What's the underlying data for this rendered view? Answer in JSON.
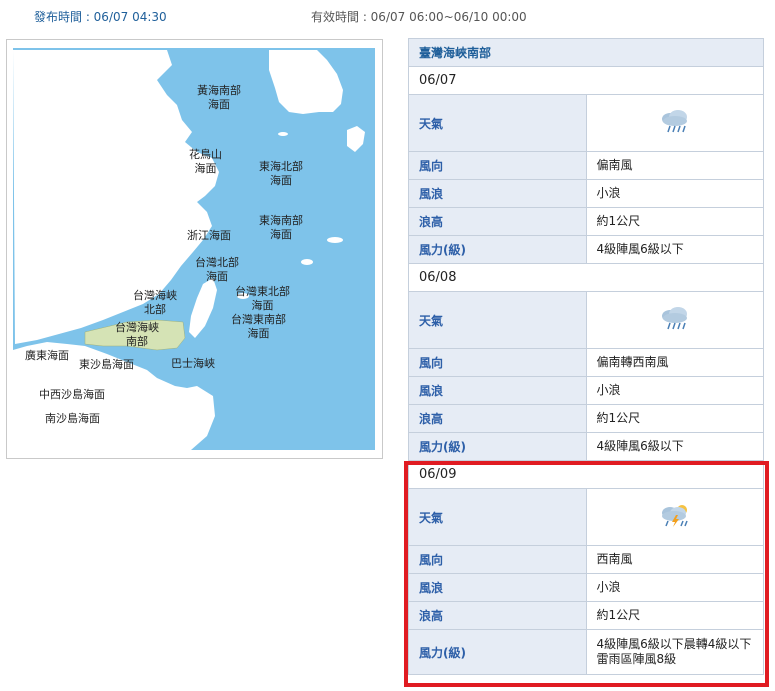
{
  "header": {
    "issue_time": "發布時間 : 06/07 04:30",
    "valid_time": "有效時間 : 06/07 06:00~06/10 00:00"
  },
  "map": {
    "labels": {
      "yellow_sea_south": "黃海南部\n海面",
      "huaniaoshan": "花鳥山\n海面",
      "east_sea_north": "東海北部\n海面",
      "east_sea_south": "東海南部\n海面",
      "zhejiang": "浙江海面",
      "taiwan_north": "台灣北部\n海面",
      "strait_north": "台灣海峽\n北部",
      "taiwan_northeast": "台灣東北部\n海面",
      "taiwan_southeast": "台灣東南部\n海面",
      "strait_south": "台灣海峽\n南部",
      "guangdong": "廣東海面",
      "dongsha": "東沙島海面",
      "bashi": "巴士海峽",
      "zhongxisha": "中西沙島海面",
      "nansha": "南沙島海面"
    },
    "colors": {
      "sea": "#7ec3ea",
      "land": "#ffffff",
      "highlight_region": "#d5e3b5"
    }
  },
  "region": "臺灣海峽南部",
  "days": [
    {
      "date": "06/07",
      "weather_icon": "rain-cloud-icon",
      "rows": [
        {
          "label": "風向",
          "value": "偏南風"
        },
        {
          "label": "風浪",
          "value": "小浪"
        },
        {
          "label": "浪高",
          "value": "約1公尺"
        },
        {
          "label": "風力(級)",
          "value": "4級陣風6級以下"
        }
      ]
    },
    {
      "date": "06/08",
      "weather_icon": "rain-cloud-icon",
      "rows": [
        {
          "label": "風向",
          "value": "偏南轉西南風"
        },
        {
          "label": "風浪",
          "value": "小浪"
        },
        {
          "label": "浪高",
          "value": "約1公尺"
        },
        {
          "label": "風力(級)",
          "value": "4級陣風6級以下"
        }
      ]
    },
    {
      "date": "06/09",
      "weather_icon": "thunderstorm-cloud-icon",
      "rows": [
        {
          "label": "風向",
          "value": "西南風"
        },
        {
          "label": "風浪",
          "value": "小浪"
        },
        {
          "label": "浪高",
          "value": "約1公尺"
        },
        {
          "label": "風力(級)",
          "value": "4級陣風6級以下晨轉4級以下雷雨區陣風8級"
        }
      ]
    }
  ],
  "weather_label": "天氣",
  "highlight_color": "#e01b22"
}
